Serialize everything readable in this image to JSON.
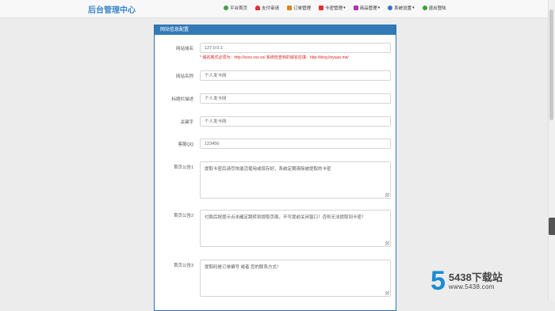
{
  "header": {
    "brand": "后台管理中心",
    "nav": [
      {
        "label": "平台首页",
        "icon": "user-icon",
        "color": "#4a9a4a",
        "dropdown": false
      },
      {
        "label": "支付审请",
        "icon": "cloud-icon",
        "color": "#e03030",
        "dropdown": false
      },
      {
        "label": "订单管理",
        "icon": "order-icon",
        "color": "#d08a20",
        "dropdown": false
      },
      {
        "label": "卡密管理",
        "icon": "card-icon",
        "color": "#e03030",
        "dropdown": true
      },
      {
        "label": "商品管理",
        "icon": "goods-icon",
        "color": "#b030b0",
        "dropdown": true
      },
      {
        "label": "系统设置",
        "icon": "gear-icon",
        "color": "#3a6fc4",
        "dropdown": true
      },
      {
        "label": "退出登陆",
        "icon": "logout-icon",
        "color": "#3aa03a",
        "dropdown": false
      }
    ]
  },
  "panel": {
    "title": "网站信息配置",
    "fields": [
      {
        "label": "网站域名",
        "value": "127.0.0.1",
        "hint": "* 域名格式必须为：http://xxxx.xxx.xx/ 系统检查到的域名应填：http://blog.linyuan.me/"
      },
      {
        "label": "网站名称",
        "value": "个人发卡网"
      },
      {
        "label": "标题栏描述",
        "value": "个人发卡网"
      },
      {
        "label": "关键字",
        "value": "个人发卡网"
      },
      {
        "label": "客服QQ",
        "value": "123456"
      }
    ],
    "notices": [
      {
        "label": "首页公告1",
        "value": "提取卡密后请尽快激活使用或保存好，系统定期清除被提取的卡密"
      },
      {
        "label": "首页公告2",
        "value": "付款后按提示点击確定跳转到提取页面，不可提前关闭窗口！否则无法提取到卡密！"
      },
      {
        "label": "首页公告3",
        "value": "提取码是订单编号 或者 您的联系方式！"
      }
    ]
  },
  "watermark": {
    "big": "5",
    "text": "5438下载站",
    "url": "www.5438.com"
  }
}
